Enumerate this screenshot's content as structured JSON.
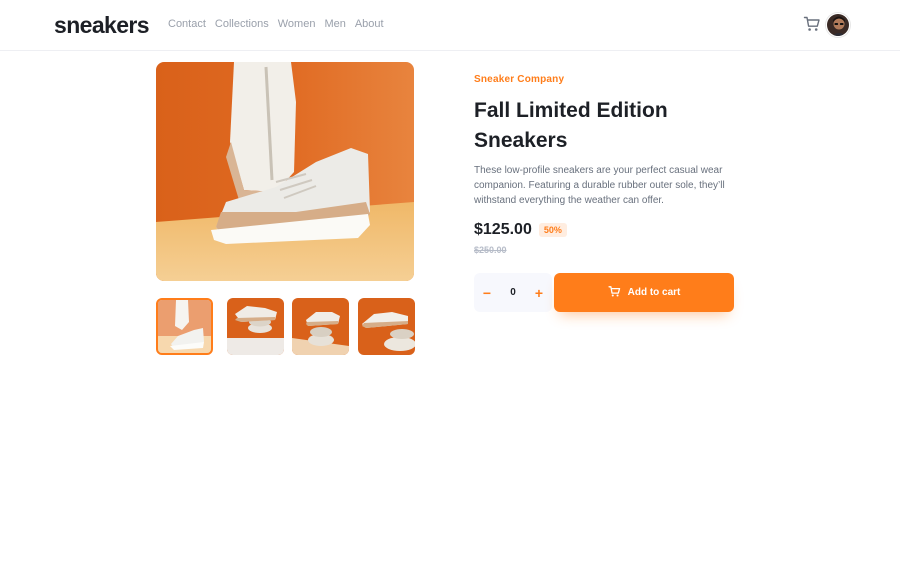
{
  "header": {
    "logo": "sneakers",
    "nav": [
      "Contact",
      "Collections",
      "Women",
      "Men",
      "About"
    ],
    "cart_icon": "cart-icon",
    "avatar": "user-avatar"
  },
  "gallery": {
    "main_image": "sneaker-photo-1",
    "thumbnails": [
      "thumbnail-1",
      "thumbnail-2",
      "thumbnail-3",
      "thumbnail-4"
    ],
    "active_thumbnail": 1
  },
  "product": {
    "company": "Sneaker Company",
    "title": "Fall Limited Edition Sneakers",
    "description": "These low-profile sneakers are your perfect casual wear companion. Featuring a durable rubber outer sole, they’ll withstand everything the weather can offer.",
    "price": "$125.00",
    "discount": "50%",
    "original_price": "$250.00"
  },
  "cart": {
    "minus": "−",
    "quantity": "0",
    "plus": "+",
    "add_label": "Add to cart"
  },
  "colors": {
    "accent": "#ff7d1a",
    "accent_pale": "#ffede0",
    "dark": "#1d2026",
    "grey": "#68707d"
  }
}
